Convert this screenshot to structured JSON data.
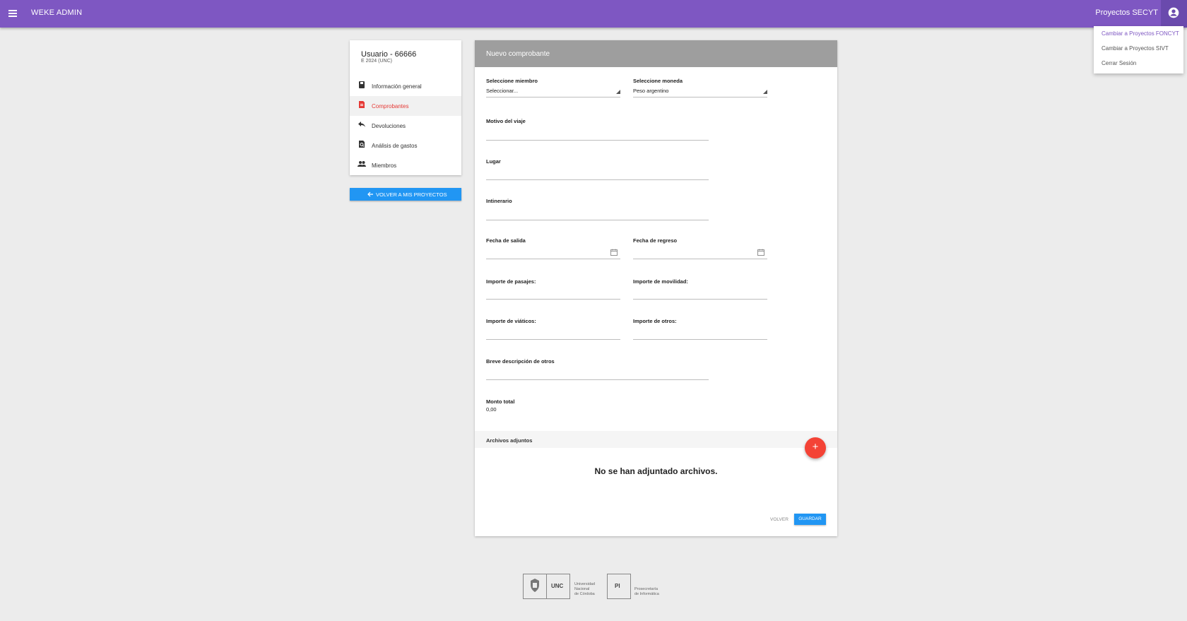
{
  "header": {
    "app_title": "WEKE ADMIN",
    "project": "Proyectos SECYT"
  },
  "user_menu": {
    "items": [
      {
        "label": "Cambiar a Proyectos FONCYT",
        "active": true
      },
      {
        "label": "Cambiar a Proyectos SIVT",
        "active": false
      },
      {
        "label": "Cerrar Sesión",
        "active": false
      }
    ]
  },
  "sidebar": {
    "user_title": "Usuario - 66666",
    "user_subtitle": "E 2024 (UNC)",
    "items": [
      {
        "label": "Información general",
        "icon": "book-icon",
        "active": false
      },
      {
        "label": "Comprobantes",
        "icon": "receipt-icon",
        "active": true
      },
      {
        "label": "Devoluciones",
        "icon": "reply-icon",
        "active": false
      },
      {
        "label": "Análisis de gastos",
        "icon": "search-document-icon",
        "active": false
      },
      {
        "label": "Miembros",
        "icon": "people-icon",
        "active": false
      }
    ],
    "back_button": "VOLVER A MIS PROYECTOS"
  },
  "form": {
    "title": "Nuevo comprobante",
    "miembro": {
      "label": "Seleccione miembro",
      "value": "Seleccionar..."
    },
    "moneda": {
      "label": "Seleccione moneda",
      "value": "Peso argentino"
    },
    "motivo": {
      "label": "Motivo del viaje",
      "value": ""
    },
    "lugar": {
      "label": "Lugar",
      "value": ""
    },
    "itinerario": {
      "label": "Intinerario",
      "value": ""
    },
    "fecha_salida": {
      "label": "Fecha de salida",
      "value": ""
    },
    "fecha_regreso": {
      "label": "Fecha de regreso",
      "value": ""
    },
    "importe_pasajes": {
      "label": "Importe de pasajes:",
      "value": ""
    },
    "importe_movilidad": {
      "label": "Importe de movilidad:",
      "value": ""
    },
    "importe_viaticos": {
      "label": "Importe de viáticos:",
      "value": ""
    },
    "importe_otros": {
      "label": "Importe de otros:",
      "value": ""
    },
    "descripcion_otros": {
      "label": "Breve descripción de otros",
      "value": ""
    },
    "monto_total": {
      "label": "Monto total",
      "value": "0,00"
    },
    "attachments_label": "Archivos adjuntos",
    "no_files": "No se han adjuntado archivos.",
    "fab_label": "+",
    "volver": "VOLVER",
    "guardar": "GUARDAR"
  },
  "footer": {
    "unc": "UNC",
    "unc_text": [
      "Universidad",
      "Nacional",
      "de Córdoba"
    ],
    "pi": "PI",
    "pi_text": [
      "Prosecretaría",
      "de Informática"
    ]
  },
  "colors": {
    "primary": "#7e57c2",
    "accent": "#2196f3",
    "active": "#e53935",
    "fab": "#f44336"
  }
}
